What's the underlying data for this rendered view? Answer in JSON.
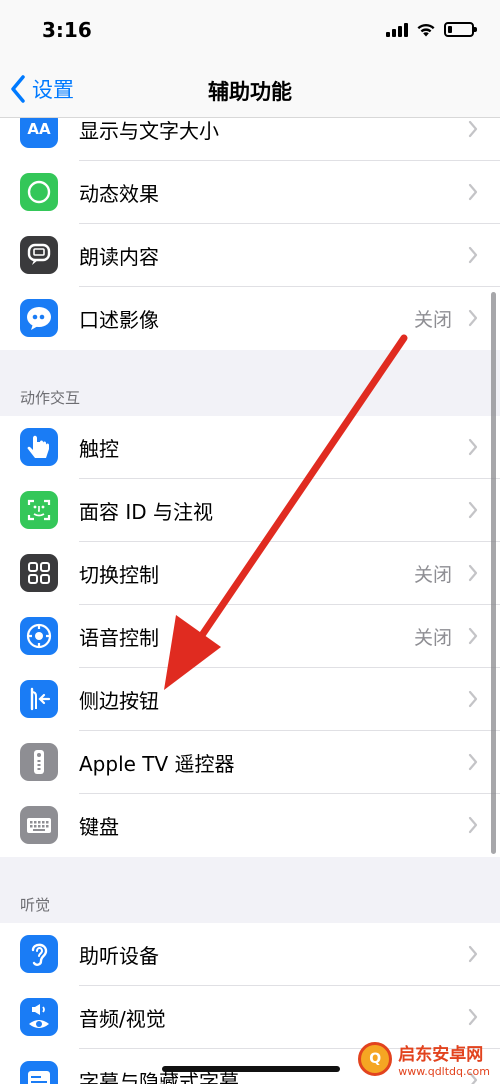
{
  "status_bar": {
    "time": "3:16",
    "battery_level": 0.2
  },
  "nav": {
    "back_label": "设置",
    "title": "辅助功能"
  },
  "sections": [
    {
      "header": "",
      "items": [
        {
          "name": "display-text-size",
          "icon": "text-size-icon",
          "icon_text": "AA",
          "color": "#1a7cf5",
          "label": "显示与文字大小",
          "value": ""
        },
        {
          "name": "motion",
          "icon": "motion-icon",
          "icon_text": "",
          "color": "#34c759",
          "label": "动态效果",
          "value": ""
        },
        {
          "name": "spoken-content",
          "icon": "speech-bubble-icon",
          "icon_text": "",
          "color": "#3a3a3c",
          "label": "朗读内容",
          "value": ""
        },
        {
          "name": "audio-descriptions",
          "icon": "quote-bubble-icon",
          "icon_text": "",
          "color": "#1a7cf5",
          "label": "口述影像",
          "value": "关闭"
        }
      ]
    },
    {
      "header": "动作交互",
      "items": [
        {
          "name": "touch",
          "icon": "hand-icon",
          "icon_text": "",
          "color": "#1a7cf5",
          "label": "触控",
          "value": ""
        },
        {
          "name": "face-id-attention",
          "icon": "face-id-icon",
          "icon_text": "",
          "color": "#34c759",
          "label": "面容 ID 与注视",
          "value": ""
        },
        {
          "name": "switch-control",
          "icon": "grid-icon",
          "icon_text": "",
          "color": "#3a3a3c",
          "label": "切换控制",
          "value": "关闭"
        },
        {
          "name": "voice-control",
          "icon": "voice-control-icon",
          "icon_text": "",
          "color": "#1a7cf5",
          "label": "语音控制",
          "value": "关闭"
        },
        {
          "name": "side-button",
          "icon": "side-button-icon",
          "icon_text": "",
          "color": "#1a7cf5",
          "label": "侧边按钮",
          "value": ""
        },
        {
          "name": "apple-tv-remote",
          "icon": "remote-icon",
          "icon_text": "",
          "color": "#8e8e93",
          "label": "Apple TV 遥控器",
          "value": ""
        },
        {
          "name": "keyboards",
          "icon": "keyboard-icon",
          "icon_text": "",
          "color": "#8e8e93",
          "label": "键盘",
          "value": ""
        }
      ]
    },
    {
      "header": "听觉",
      "items": [
        {
          "name": "hearing-devices",
          "icon": "ear-icon",
          "icon_text": "",
          "color": "#1a7cf5",
          "label": "助听设备",
          "value": ""
        },
        {
          "name": "audio-visual",
          "icon": "speaker-eye-icon",
          "icon_text": "",
          "color": "#1a7cf5",
          "label": "音频/视觉",
          "value": ""
        },
        {
          "name": "subtitles-captioning",
          "icon": "captions-icon",
          "icon_text": "",
          "color": "#1a7cf5",
          "label": "字幕与隐藏式字幕",
          "value": ""
        }
      ]
    }
  ],
  "watermark": {
    "title": "启东安卓网",
    "url": "www.qdltdq.com",
    "logo_text": "Q"
  }
}
